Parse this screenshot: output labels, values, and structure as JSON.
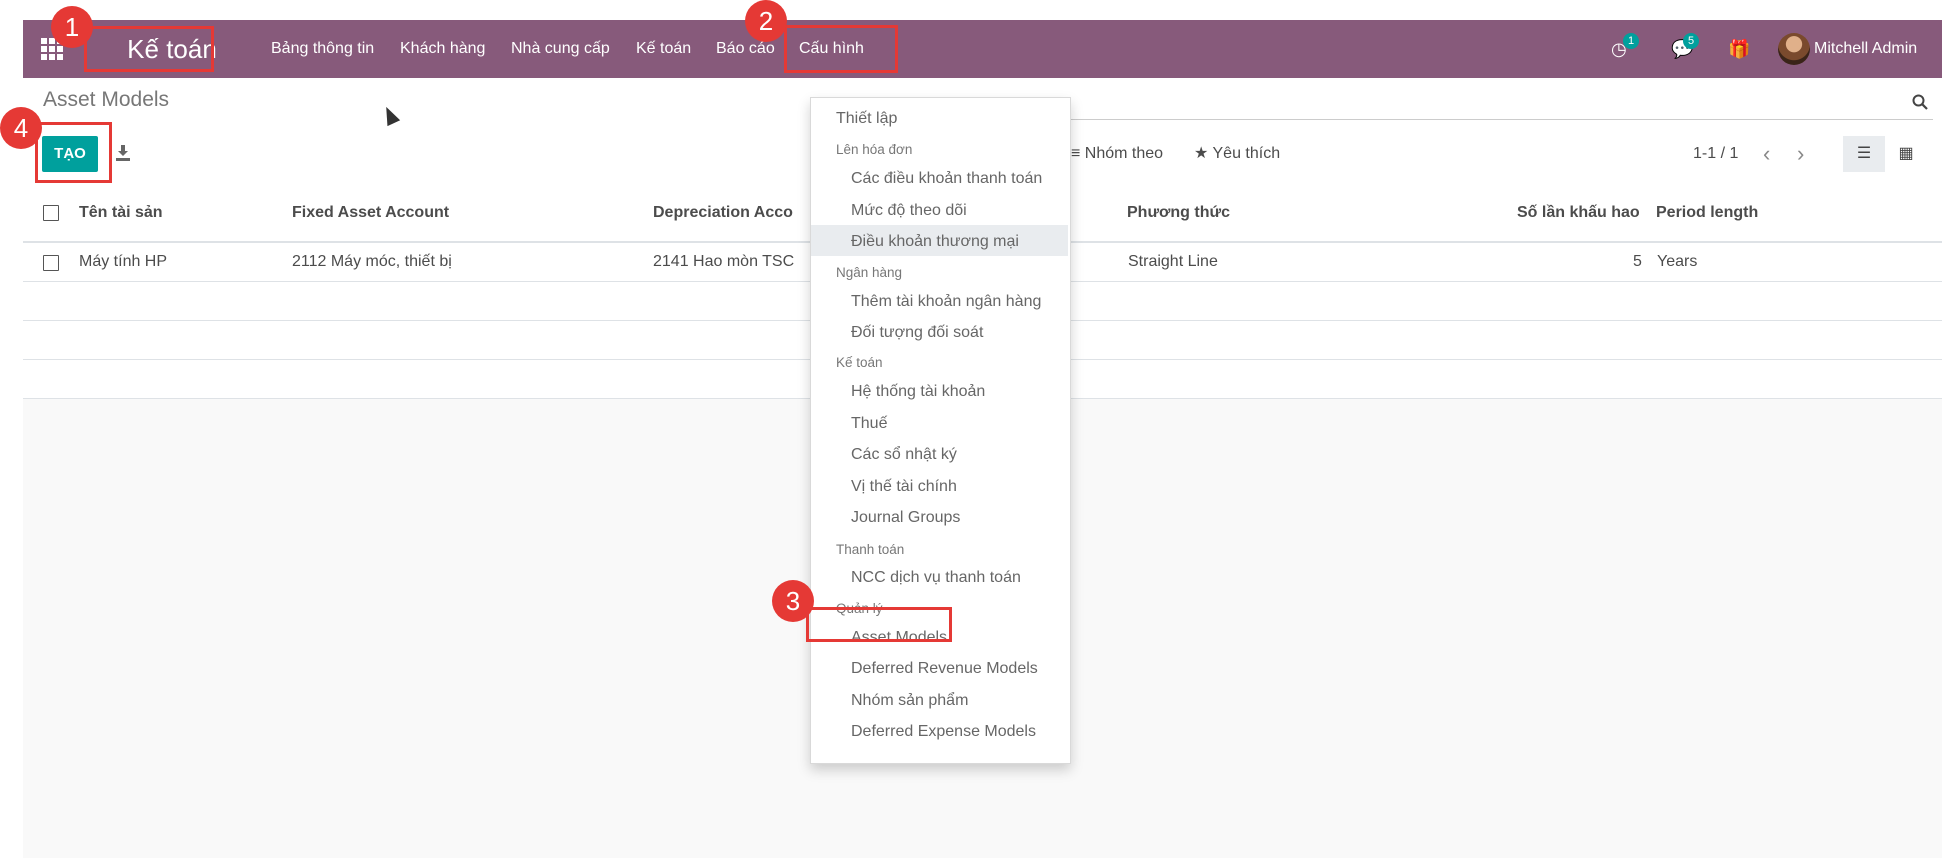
{
  "navbar": {
    "app_title": "Kế toán",
    "menu": [
      "Bảng thông tin",
      "Khách hàng",
      "Nhà cung cấp",
      "Kế toán",
      "Báo cáo",
      "Cấu hình"
    ],
    "activity_count": "1",
    "message_count": "5",
    "user_name": "Mitchell Admin"
  },
  "control_panel": {
    "breadcrumb": "Asset Models",
    "create_label": "TẠO",
    "group_by_label": "Nhóm theo",
    "favorites_label": "Yêu thích",
    "pager": "1-1 / 1"
  },
  "table": {
    "columns": [
      "Tên tài sản",
      "Fixed Asset Account",
      "Depreciation Acco",
      "Phương thức",
      "Số lần khấu hao",
      "Period length"
    ],
    "rows": [
      {
        "name": "Máy tính HP",
        "fixed_account": "2112 Máy móc, thiết bị",
        "depreciation_account": "2141 Hao mòn TSC",
        "method": "Straight Line",
        "count": "5",
        "period": "Years"
      }
    ]
  },
  "dropdown": {
    "first_item": "Thiết lập",
    "sections": [
      {
        "header": "Lên hóa đơn",
        "items": [
          "Các điều khoản thanh toán",
          "Mức độ theo dõi",
          "Điều khoản thương mại"
        ]
      },
      {
        "header": "Ngân hàng",
        "items": [
          "Thêm tài khoản ngân hàng",
          "Đối tượng đối soát"
        ]
      },
      {
        "header": "Kế toán",
        "items": [
          "Hệ thống tài khoản",
          "Thuế",
          "Các sổ nhật ký",
          "Vị thế tài chính",
          "Journal Groups"
        ]
      },
      {
        "header": "Thanh toán",
        "items": [
          "NCC dịch vụ thanh toán"
        ]
      },
      {
        "header": "Quản lý",
        "items": [
          "Asset Models",
          "Deferred Revenue Models",
          "Nhóm sản phẩm",
          "Deferred Expense Models"
        ]
      }
    ]
  },
  "markers": [
    "1",
    "2",
    "3",
    "4"
  ],
  "colors": {
    "navbar": "#875a7b",
    "primary": "#00a09d",
    "highlight": "#e53935"
  }
}
